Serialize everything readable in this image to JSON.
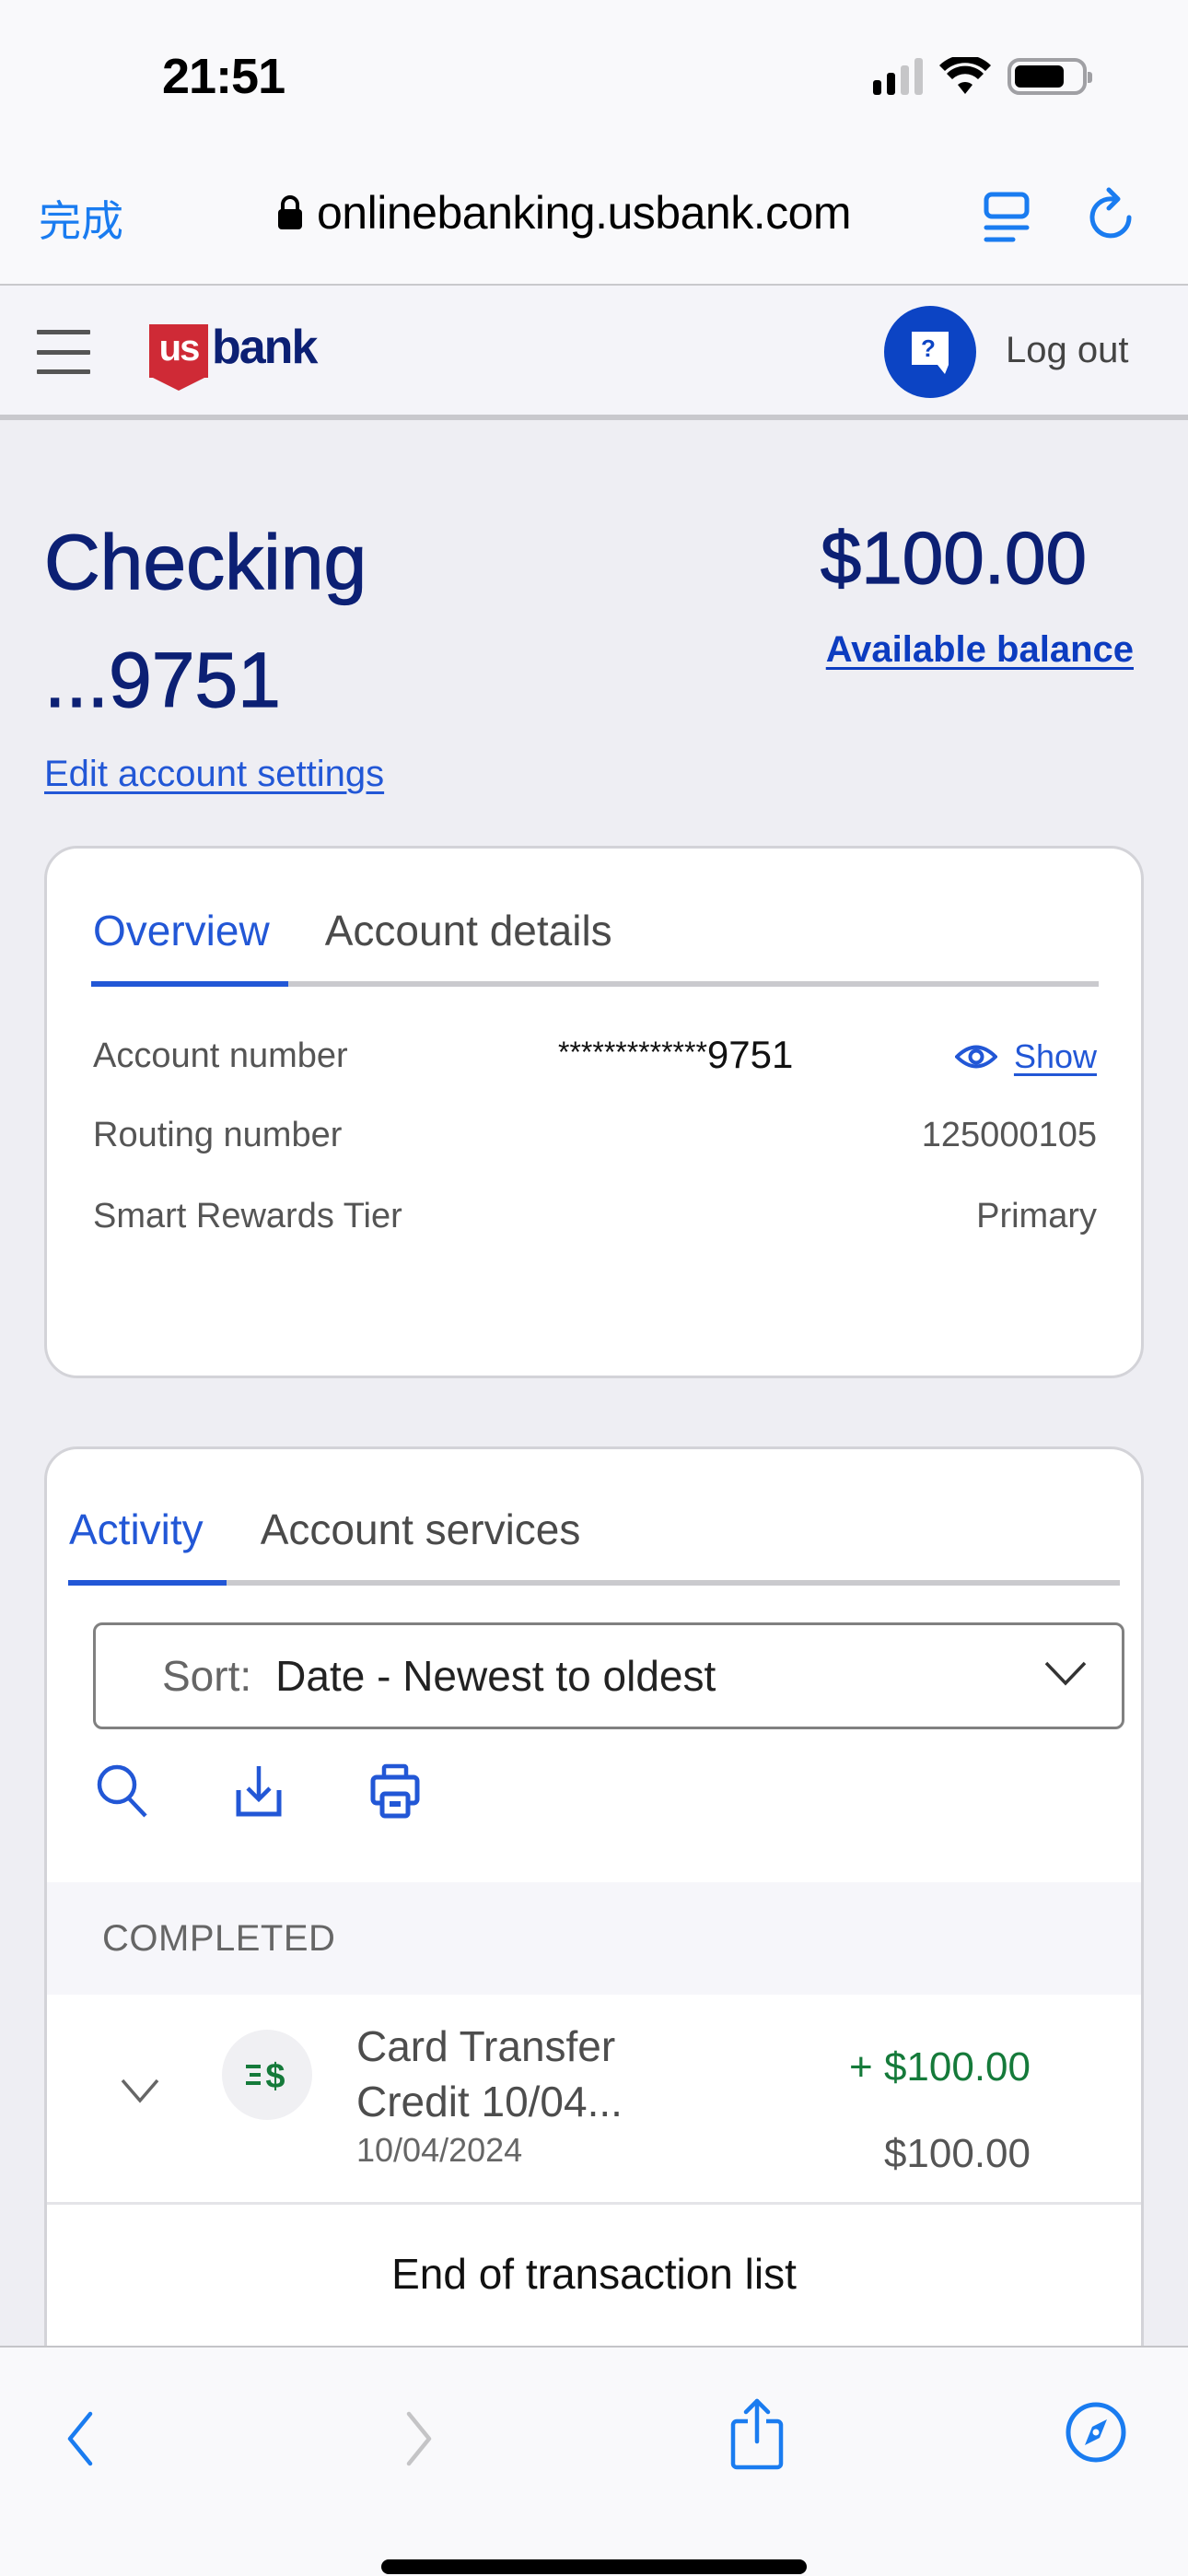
{
  "status_bar": {
    "time": "21:51",
    "icons": [
      "cellular-signal-icon",
      "wifi-icon",
      "battery-icon"
    ]
  },
  "browser": {
    "done_label": "完成",
    "url": "onlinebanking.usbank.com",
    "icons": [
      "lock-icon",
      "reader-view-icon",
      "reload-icon"
    ],
    "toolbar_icons": [
      "back-icon",
      "forward-icon",
      "share-icon",
      "compass-icon"
    ],
    "accent_color": "#1a7cf0"
  },
  "header": {
    "logo_us": "us",
    "logo_bank": "bank",
    "help_icon": "help-chat-icon",
    "logout_label": "Log out",
    "brand_red": "#cf2a36",
    "brand_navy": "#0c2074"
  },
  "account": {
    "name": "Checking",
    "masked_number": "...9751",
    "balance": "$100.00",
    "balance_label": "Available balance",
    "edit_link": "Edit account settings"
  },
  "overview_card": {
    "tabs": [
      {
        "label": "Overview",
        "active": true
      },
      {
        "label": "Account details",
        "active": false
      }
    ],
    "rows": [
      {
        "label": "Account number",
        "value_stars": "*************",
        "value_digits": "9751",
        "action": "Show"
      },
      {
        "label": "Routing number",
        "value": "125000105"
      },
      {
        "label": "Smart Rewards Tier",
        "value": "Primary"
      }
    ]
  },
  "activity_card": {
    "tabs": [
      {
        "label": "Activity",
        "active": true
      },
      {
        "label": "Account services",
        "active": false
      }
    ],
    "sort": {
      "label": "Sort:",
      "value": "Date - Newest to oldest"
    },
    "tools": [
      "search-icon",
      "download-icon",
      "print-icon"
    ],
    "section_header": "COMPLETED",
    "transactions": [
      {
        "description": "Card Transfer Credit 10/04...",
        "date": "10/04/2024",
        "amount": "+ $100.00",
        "running_balance": "$100.00",
        "icon": "money-transfer-icon"
      }
    ],
    "end_message": "End of transaction list",
    "positive_color": "#157a3a"
  }
}
